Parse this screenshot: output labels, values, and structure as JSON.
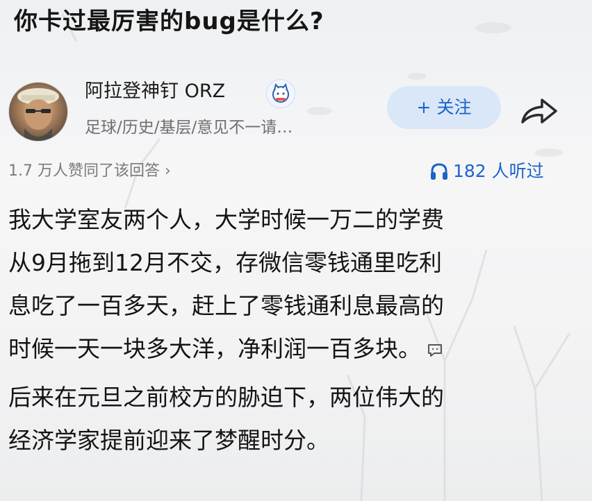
{
  "question": {
    "title": "你卡过最厉害的bug是什么?"
  },
  "author": {
    "name": "阿拉登神钉 ORZ",
    "tags": "足球/历史/基层/意见不一请…",
    "avatar_icon": "avatar-photo",
    "badge_icon": "cat-badge-icon"
  },
  "follow": {
    "label": "+ 关注"
  },
  "share": {
    "icon": "share-arrow-icon"
  },
  "stats": {
    "likes": "1.7 万人赞同了该回答 ›",
    "listens": "182 人听过",
    "listen_icon": "headphones-icon"
  },
  "answer": {
    "paragraph_1": [
      "我大学室友两个人，大学时候一万二的学费",
      "从9月拖到12月不交，存微信零钱通里吃利",
      "息吃了一百多天，赶上了零钱通利息最高的",
      "时候一天一块多大洋，净利润一百多块。"
    ],
    "paragraph_2": [
      "后来在元旦之前校方的胁迫下，两位伟大的",
      "经济学家提前迎来了梦醒时分。"
    ],
    "comment_icon": "comment-bubble-icon"
  },
  "colors": {
    "accent_blue": "#1c63c9",
    "follow_bg": "#d5e4f8",
    "text_primary": "#141414",
    "text_secondary": "#6e6e6e"
  }
}
